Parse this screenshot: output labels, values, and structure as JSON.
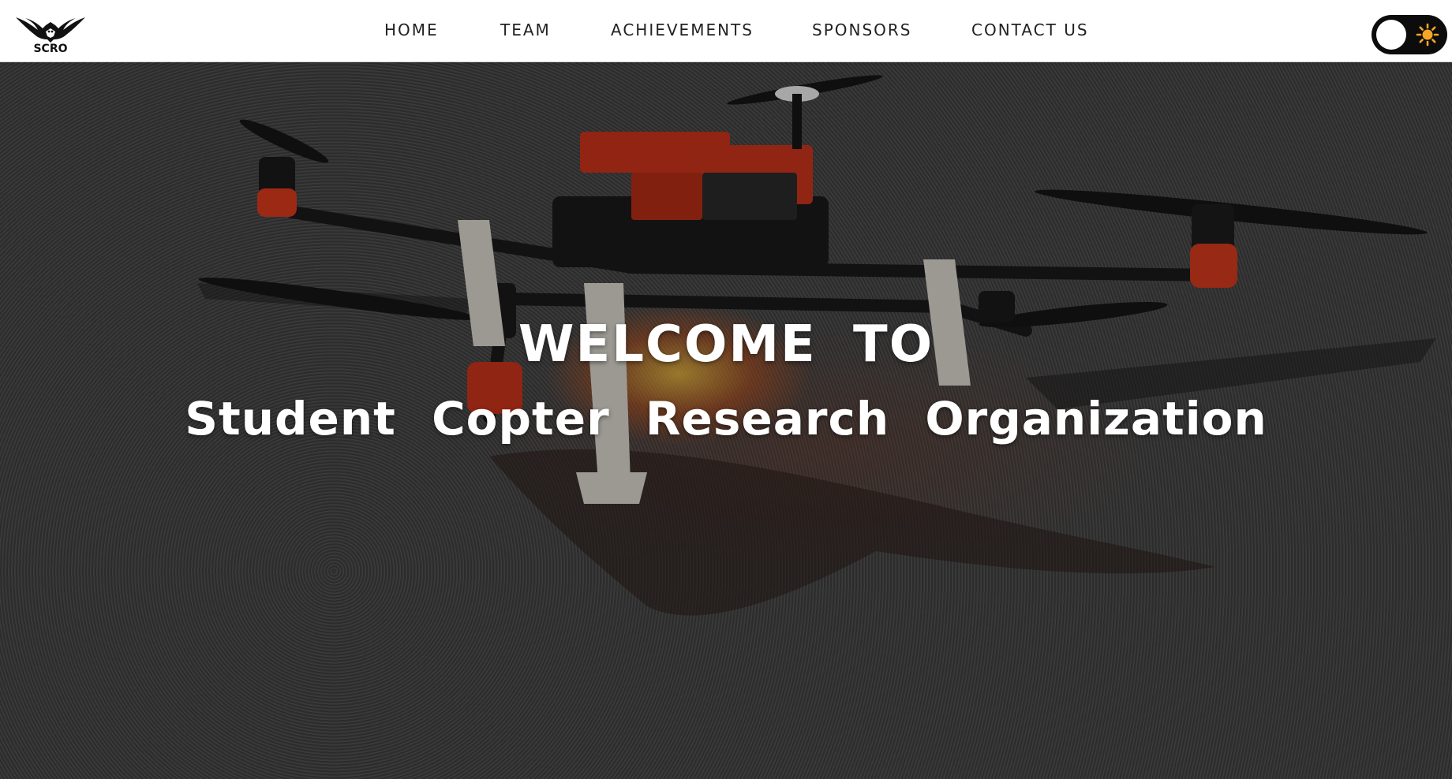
{
  "logo": {
    "text": "SCRO",
    "icon": "eagle-icon"
  },
  "nav": {
    "items": [
      {
        "label": "HOME"
      },
      {
        "label": "TEAM"
      },
      {
        "label": "ACHIEVEMENTS"
      },
      {
        "label": "SPONSORS"
      },
      {
        "label": "CONTACT US"
      }
    ]
  },
  "theme_toggle": {
    "mode": "light",
    "icon": "sun-icon",
    "icon_color": "#f5a623"
  },
  "hero": {
    "title": "WELCOME  TO",
    "subtitle": "Student  Copter  Research  Organization",
    "background_image": "hexacopter-drone-photo"
  },
  "colors": {
    "navbar_bg": "#ffffff",
    "nav_text": "#222222",
    "toggle_bg": "#0c0c0c",
    "hero_text": "#ffffff"
  }
}
